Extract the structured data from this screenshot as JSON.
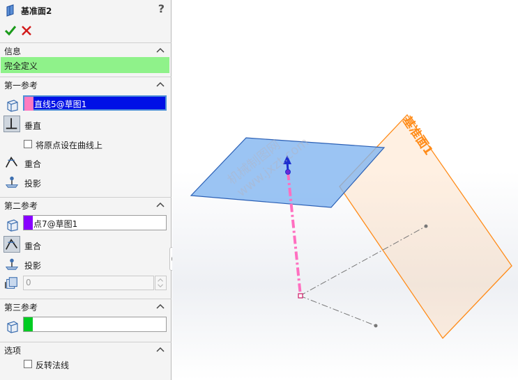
{
  "title": "基准面2",
  "help": "?",
  "colors": {
    "status_green": "#8ff28a",
    "pink": "#ff7ac0",
    "purple": "#8800ff",
    "green": "#00cc22",
    "plane_blue": "#7fb4f0",
    "plane_orange": "#ff8c1a"
  },
  "info": {
    "header": "信息",
    "status": "完全定义"
  },
  "first_ref": {
    "header": "第一参考",
    "selection": "直线5@草图1",
    "constraint_perpendicular": "垂直",
    "checkbox_origin": "将原点设在曲线上",
    "constraint_coincident": "重合",
    "constraint_project": "投影"
  },
  "second_ref": {
    "header": "第二参考",
    "selection": "点7@草图1",
    "constraint_coincident": "重合",
    "constraint_project": "投影",
    "distance_value": "0"
  },
  "third_ref": {
    "header": "第三参考",
    "selection": ""
  },
  "options": {
    "header": "选项",
    "checkbox_flip": "反转法线"
  },
  "viewport": {
    "plane_label": "基准面1",
    "watermark_1": "机械制图网",
    "watermark_2": "www.jxzt.com"
  }
}
